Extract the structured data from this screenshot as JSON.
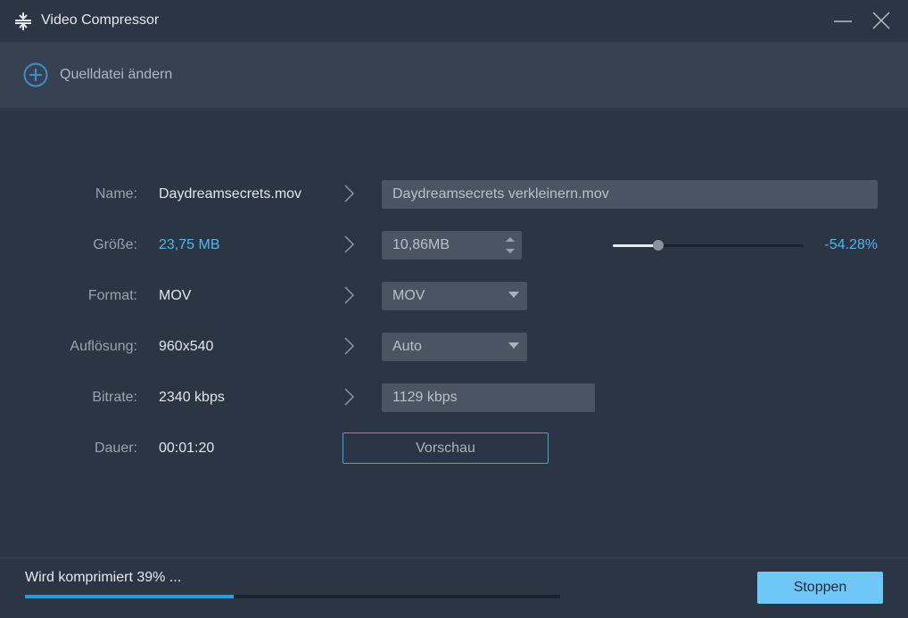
{
  "window": {
    "title": "Video Compressor",
    "icon": "compress-icon"
  },
  "source": {
    "label": "Quelldatei ändern",
    "icon": "add-circle-icon"
  },
  "rows": {
    "name": {
      "label": "Name:",
      "source_value": "Daydreamsecrets.mov",
      "target_value": "Daydreamsecrets verkleinern.mov"
    },
    "size": {
      "label": "Größe:",
      "source_value": "23,75 MB",
      "target_value": "10,86MB",
      "percent_text": "-54.28%",
      "slider_fraction": 0.24
    },
    "format": {
      "label": "Format:",
      "source_value": "MOV",
      "target_value": "MOV"
    },
    "resolution": {
      "label": "Auflösung:",
      "source_value": "960x540",
      "target_value": "Auto"
    },
    "bitrate": {
      "label": "Bitrate:",
      "source_value": "2340 kbps",
      "target_value": "1129 kbps"
    },
    "duration": {
      "label": "Dauer:",
      "source_value": "00:01:20"
    }
  },
  "preview_button": "Vorschau",
  "footer": {
    "status": "Wird komprimiert 39% ...",
    "progress_fraction": 0.39,
    "stop_button": "Stoppen"
  },
  "colors": {
    "background": "#2b3544",
    "accent": "#4fb8ef",
    "progress": "#1ea0e8",
    "stop_button": "#6ec7f6"
  }
}
